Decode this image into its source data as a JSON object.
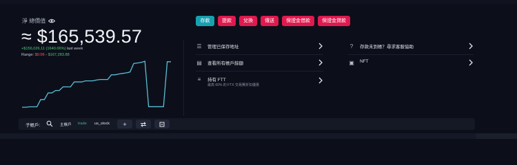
{
  "balance": {
    "label": "淨 總價值",
    "value": "≈ $165,539.57",
    "change": "+$156,026.11 (1640.06%)",
    "change_period": "last week",
    "range_label": "Range:",
    "range_low": "$0.06",
    "range_sep": " - ",
    "range_high": "$167,283.88"
  },
  "chart_data": {
    "type": "line",
    "title": "",
    "xlabel": "",
    "ylabel": "",
    "color": "#5bbfd6",
    "x": [
      0,
      1,
      2,
      3,
      4,
      5,
      6,
      7,
      8,
      9,
      10,
      11,
      12,
      13,
      14,
      15,
      16,
      17,
      18,
      19,
      20,
      21,
      22,
      23,
      24,
      25,
      26,
      27,
      28,
      29,
      30,
      31,
      32,
      33,
      34,
      35,
      36,
      37,
      38,
      39,
      40
    ],
    "values": [
      0.06,
      0.06,
      1500,
      1500,
      1500,
      28000,
      28000,
      52000,
      52000,
      61000,
      61000,
      74000,
      74000,
      74000,
      92000,
      92000,
      92000,
      96000,
      96000,
      96000,
      99000,
      101000,
      101000,
      101000,
      118000,
      118000,
      121000,
      123000,
      125000,
      128000,
      159000,
      161000,
      163000,
      167283.88,
      2000,
      2000,
      2000,
      2000,
      2000,
      165539.57,
      165539.57
    ],
    "ylim": [
      0,
      170000
    ]
  },
  "actions": [
    {
      "label": "存款",
      "color": "#17a1b0"
    },
    {
      "label": "提款",
      "color": "#e0194f"
    },
    {
      "label": "兌換",
      "color": "#e0194f"
    },
    {
      "label": "傳送",
      "color": "#e0194f"
    },
    {
      "label": "保證金借款",
      "color": "#e0194f"
    },
    {
      "label": "保證金貸款",
      "color": "#e0194f"
    }
  ],
  "menu": {
    "saved_addresses": "管理已保存地址",
    "all_accounts": "查看所有帳戶餘額",
    "ftt_title": "持有 FTT",
    "ftt_sub": "最高 60% 的 FTX 交易費折扣優惠",
    "deposit_help": "存款未到帳？尋求客服協助",
    "nft": "NFT"
  },
  "toolbar": {
    "label": "子帳戶:",
    "tabs": [
      "主帳戶",
      "trade",
      "us_stock"
    ],
    "active_tab_color": "#3fb68b"
  }
}
